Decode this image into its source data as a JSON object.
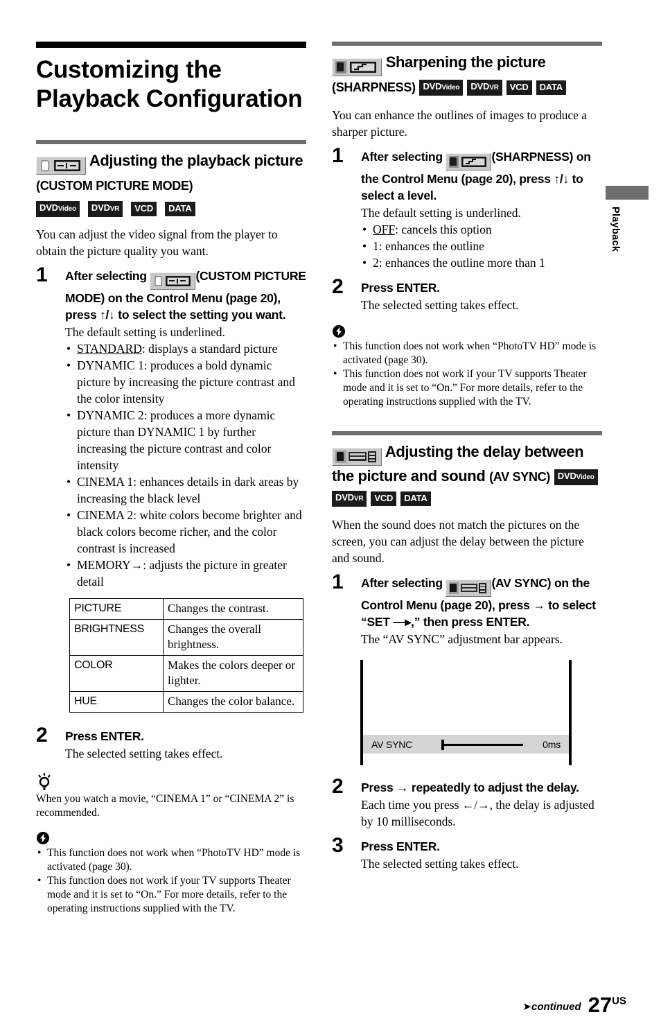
{
  "chapter": {
    "title": "Customizing the Playback Configuration"
  },
  "side_tab": {
    "label": "Playback"
  },
  "badges": {
    "dvd_video_main": "DVD",
    "dvd_video_sub": "Video",
    "dvd_vr_main": "DVD",
    "dvd_vr_sub": "VR",
    "vcd": "VCD",
    "data": "DATA"
  },
  "sections": [
    {
      "icon_name": "custom-picture-mode-icon",
      "heading_main": "Adjusting the playback picture",
      "heading_sub": "(CUSTOM PICTURE MODE)",
      "intro": "You can adjust the video signal from the player to obtain the picture quality you want.",
      "step1_num": "1",
      "step1_title_a": "After selecting",
      "step1_title_b": "(CUSTOM PICTURE MODE) on the Control Menu (page 20), press ↑/↓ to select the setting you want.",
      "step1_body": "The default setting is underlined.",
      "options": [
        {
          "term": "STANDARD",
          "underline": true,
          "rest": ": displays a standard picture"
        },
        {
          "term": "DYNAMIC 1",
          "underline": false,
          "rest": ": produces a bold dynamic picture by increasing the picture contrast and the color intensity"
        },
        {
          "term": "DYNAMIC 2",
          "underline": false,
          "rest": ": produces a more dynamic picture than DYNAMIC 1 by further increasing the picture contrast and color intensity"
        },
        {
          "term": "CINEMA 1",
          "underline": false,
          "rest": ": enhances details in dark areas by increasing the black level"
        },
        {
          "term": "CINEMA 2",
          "underline": false,
          "rest": ": white colors become brighter and black colors become richer, and the color contrast is increased"
        },
        {
          "term": "MEMORY→",
          "underline": false,
          "rest": ": adjusts the picture in greater detail"
        }
      ],
      "table": [
        {
          "key": "PICTURE",
          "value": "Changes the contrast."
        },
        {
          "key": "BRIGHTNESS",
          "value": "Changes the overall brightness."
        },
        {
          "key": "COLOR",
          "value": "Makes the colors deeper or lighter."
        },
        {
          "key": "HUE",
          "value": "Changes the color balance."
        }
      ],
      "step2_num": "2",
      "step2_title": "Press ENTER.",
      "step2_body": "The selected setting takes effect.",
      "tip": "When you watch a movie, “CINEMA 1” or “CINEMA 2” is recommended.",
      "notes": [
        "This function does not work when “PhotoTV HD” mode is activated (page 30).",
        "This function does not work if your TV supports Theater mode and it is set to “On.” For more details, refer to the operating instructions supplied with the TV."
      ]
    },
    {
      "icon_name": "sharpness-icon",
      "heading_main": "Sharpening the picture",
      "heading_sub": "(SHARPNESS)",
      "intro": "You can enhance the outlines of images to produce a sharper picture.",
      "step1_num": "1",
      "step1_title_a": "After selecting",
      "step1_title_b": "(SHARPNESS) on the Control Menu (page 20), press ↑/↓ to select a level.",
      "step1_body": "The default setting is underlined.",
      "options": [
        {
          "term": "OFF",
          "underline": true,
          "rest": ": cancels this option"
        },
        {
          "term": "1",
          "underline": false,
          "rest": ": enhances the outline"
        },
        {
          "term": "2",
          "underline": false,
          "rest": ": enhances the outline more than 1"
        }
      ],
      "step2_num": "2",
      "step2_title": "Press ENTER.",
      "step2_body": "The selected setting takes effect.",
      "notes": [
        "This function does not work when “PhotoTV HD” mode is activated (page 30).",
        "This function does not work if your TV supports Theater mode and it is set to “On.” For more details, refer to the operating instructions supplied with the TV."
      ]
    },
    {
      "icon_name": "av-sync-icon",
      "heading_main": "Adjusting the delay between the picture and sound",
      "heading_sub": "(AV SYNC)",
      "intro": "When the sound does not match the pictures on the screen, you can adjust the delay between the picture and sound.",
      "step1_num": "1",
      "step1_title_a": "After selecting",
      "step1_title_b": "(AV SYNC) on the Control Menu (page 20), press → to select “SET —▸,” then press ENTER.",
      "step1_body": "The “AV SYNC” adjustment bar appears.",
      "osd": {
        "label": "AV SYNC",
        "value": "0ms"
      },
      "step2_num": "2",
      "step2_title": "Press → repeatedly to adjust the delay.",
      "step2_body": "Each time you press ←/→, the delay is adjusted by 10 milliseconds.",
      "step3_num": "3",
      "step3_title": "Press ENTER.",
      "step3_body": "The selected setting takes effect."
    }
  ],
  "footer": {
    "continued": "continued",
    "page_number": "27",
    "page_suffix": "US"
  }
}
